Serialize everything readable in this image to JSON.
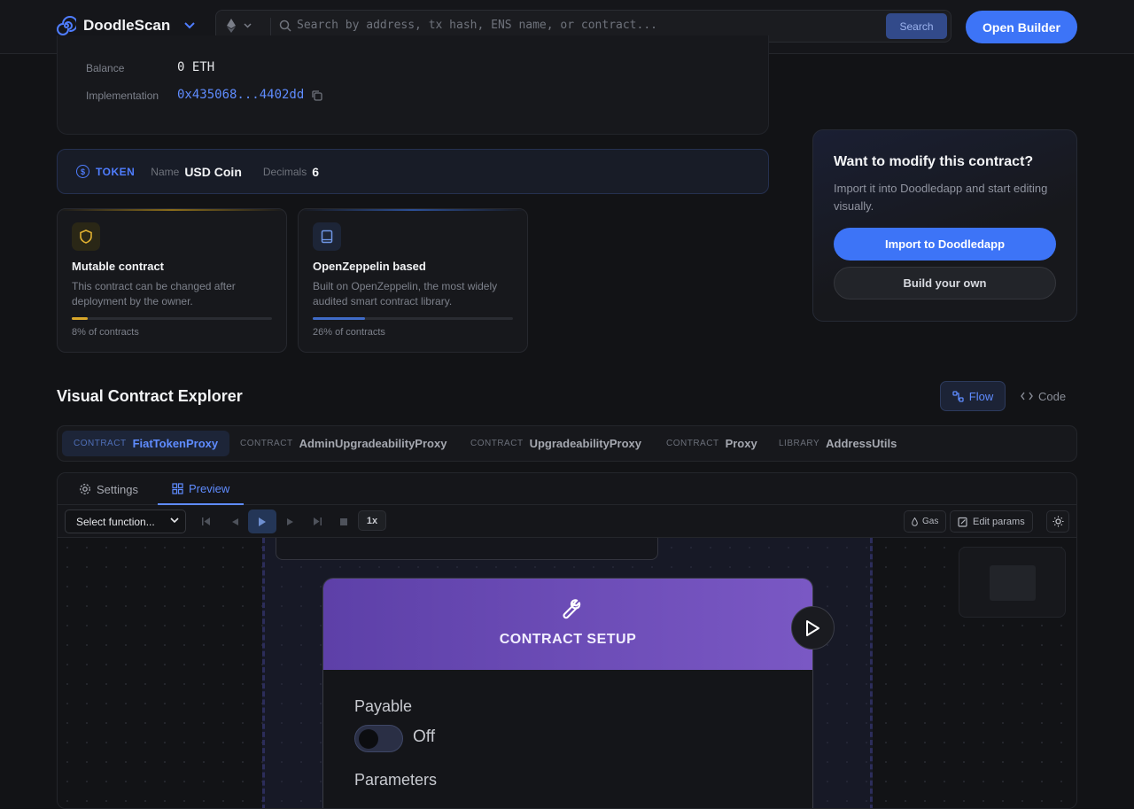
{
  "header": {
    "brand": "DoodleScan",
    "search_placeholder": "Search by address, tx hash, ENS name, or contract...",
    "search_button": "Search",
    "open_builder": "Open Builder"
  },
  "overview": {
    "balance_label": "Balance",
    "balance_value": "0 ETH",
    "implementation_label": "Implementation",
    "implementation_value": "0x435068...4402dd"
  },
  "token": {
    "label": "TOKEN",
    "name_key": "Name",
    "name_value": "USD Coin",
    "decimals_key": "Decimals",
    "decimals_value": "6"
  },
  "features": [
    {
      "title": "Mutable contract",
      "desc": "This contract can be changed after deployment by the owner.",
      "pct_label": "8% of contracts",
      "pct": 8,
      "color": "#d8a72a",
      "icon": "shield-icon"
    },
    {
      "title": "OpenZeppelin based",
      "desc": "Built on OpenZeppelin, the most widely audited smart contract library.",
      "pct_label": "26% of contracts",
      "pct": 26,
      "color": "#3f6bc8",
      "icon": "book-icon"
    }
  ],
  "cta": {
    "title": "Want to modify this contract?",
    "desc": "Import it into Doodledapp and start editing visually.",
    "primary": "Import to Doodledapp",
    "secondary": "Build your own"
  },
  "explorer": {
    "title": "Visual Contract Explorer",
    "flow_label": "Flow",
    "code_label": "Code",
    "tabs": [
      {
        "kind": "CONTRACT",
        "name": "FiatTokenProxy"
      },
      {
        "kind": "CONTRACT",
        "name": "AdminUpgradeabilityProxy"
      },
      {
        "kind": "CONTRACT",
        "name": "UpgradeabilityProxy"
      },
      {
        "kind": "CONTRACT",
        "name": "Proxy"
      },
      {
        "kind": "LIBRARY",
        "name": "AddressUtils"
      }
    ]
  },
  "panel": {
    "tab_settings": "Settings",
    "tab_preview": "Preview",
    "function_select": "Select function...",
    "speed": "1x",
    "gas": "Gas",
    "edit_params": "Edit params",
    "node_title": "CONTRACT SETUP",
    "payable_label": "Payable",
    "payable_state": "Off",
    "parameters_label": "Parameters"
  }
}
